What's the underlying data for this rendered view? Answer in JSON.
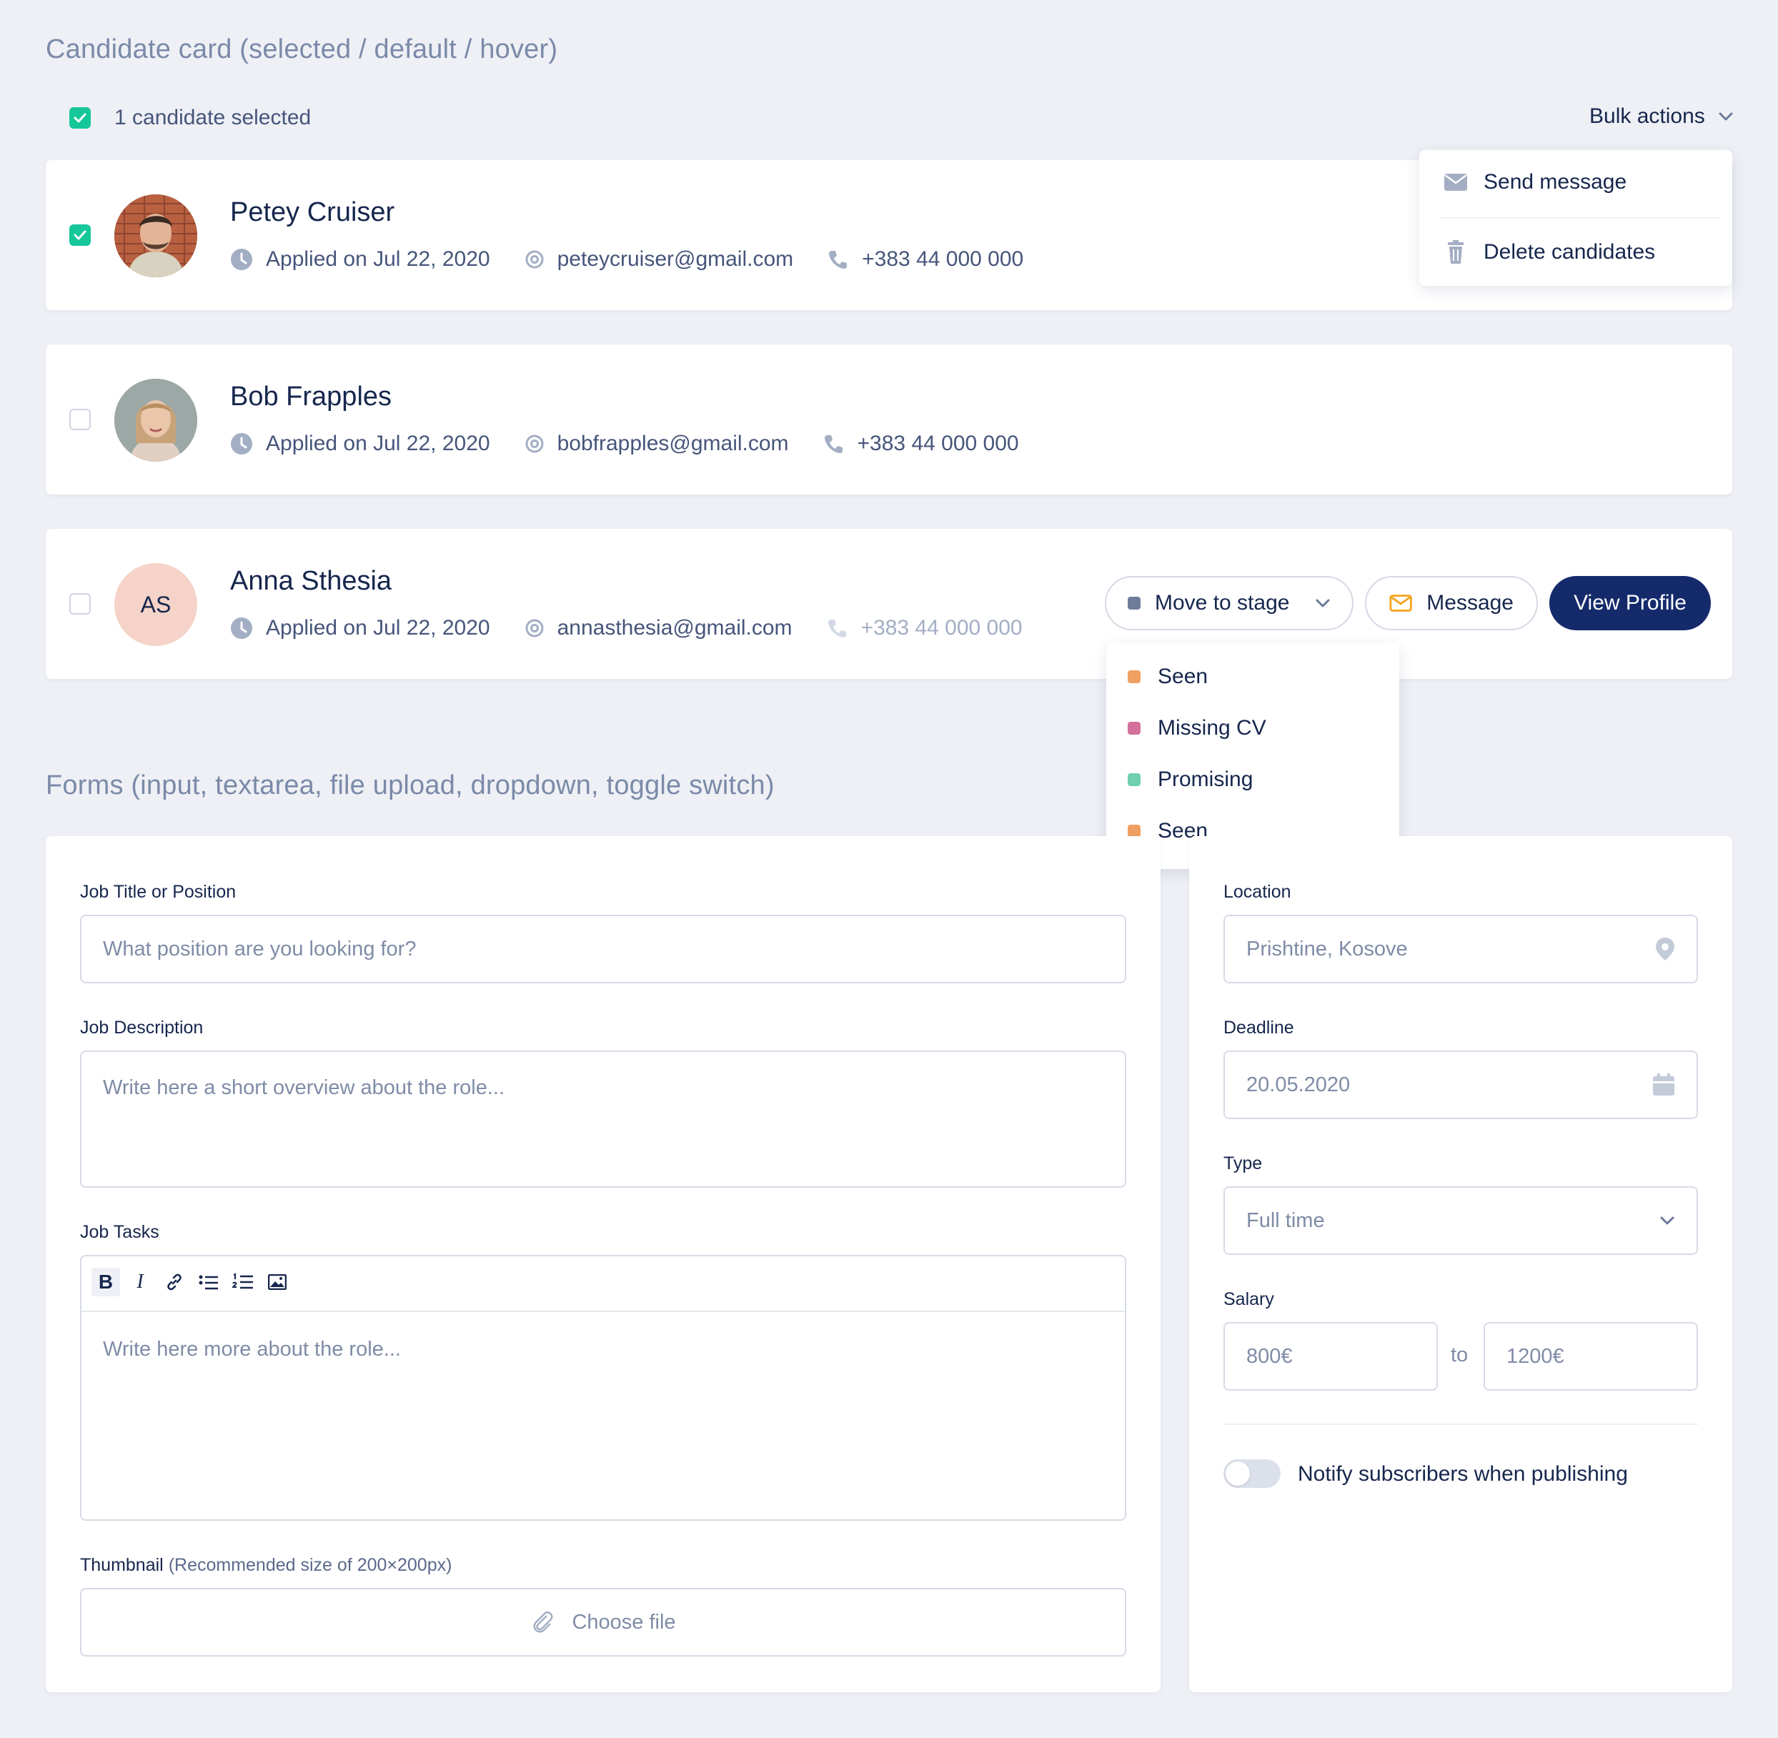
{
  "candidate_section": {
    "title": "Candidate card (selected / default / hover)",
    "selected_count_label": "1 candidate selected",
    "bulk_actions_label": "Bulk actions",
    "bulk_menu": {
      "send_message": "Send message",
      "delete_candidates": "Delete candidates"
    },
    "candidates": [
      {
        "name": "Petey Cruiser",
        "applied": "Applied on Jul 22, 2020",
        "email": "peteycruiser@gmail.com",
        "phone": "+383 44 000 000",
        "selected": true
      },
      {
        "name": "Bob Frapples",
        "applied": "Applied on Jul 22, 2020",
        "email": "bobfrapples@gmail.com",
        "phone": "+383 44 000 000",
        "selected": false
      },
      {
        "name": "Anna Sthesia",
        "initials": "AS",
        "applied": "Applied on Jul 22, 2020",
        "email": "annasthesia@gmail.com",
        "phone": "+383 44 000 000",
        "selected": false
      }
    ],
    "actions": {
      "move_to_stage": "Move to stage",
      "message": "Message",
      "view_profile": "View Profile"
    },
    "stages": [
      {
        "label": "Seen",
        "color": "#f0a062"
      },
      {
        "label": "Missing CV",
        "color": "#d4709b"
      },
      {
        "label": "Promising",
        "color": "#6fcfae"
      },
      {
        "label": "Seen",
        "color": "#f0a062"
      }
    ]
  },
  "forms_section": {
    "title": "Forms (input, textarea, file upload, dropdown, toggle switch)",
    "job_title": {
      "label": "Job Title or Position",
      "placeholder": "What position are you looking for?"
    },
    "job_description": {
      "label": "Job Description",
      "placeholder": "Write here a short overview about the role..."
    },
    "job_tasks": {
      "label": "Job Tasks",
      "placeholder": "Write here more about the role...",
      "toolbar": {
        "bold": "B",
        "italic": "I"
      }
    },
    "thumbnail": {
      "label": "Thumbnail",
      "hint": "(Recommended size of 200×200px)",
      "button": "Choose file"
    },
    "location": {
      "label": "Location",
      "value": "Prishtine, Kosove"
    },
    "deadline": {
      "label": "Deadline",
      "value": "20.05.2020"
    },
    "type": {
      "label": "Type",
      "value": "Full time"
    },
    "salary": {
      "label": "Salary",
      "from": "800€",
      "separator": "to",
      "to": "1200€"
    },
    "notify": {
      "label": "Notify subscribers when publishing",
      "enabled": false
    }
  },
  "colors": {
    "accent_green": "#16c79a",
    "primary_navy": "#142a6b",
    "avatar_bg": "#f5d3c8",
    "message_icon": "#f5a623"
  }
}
